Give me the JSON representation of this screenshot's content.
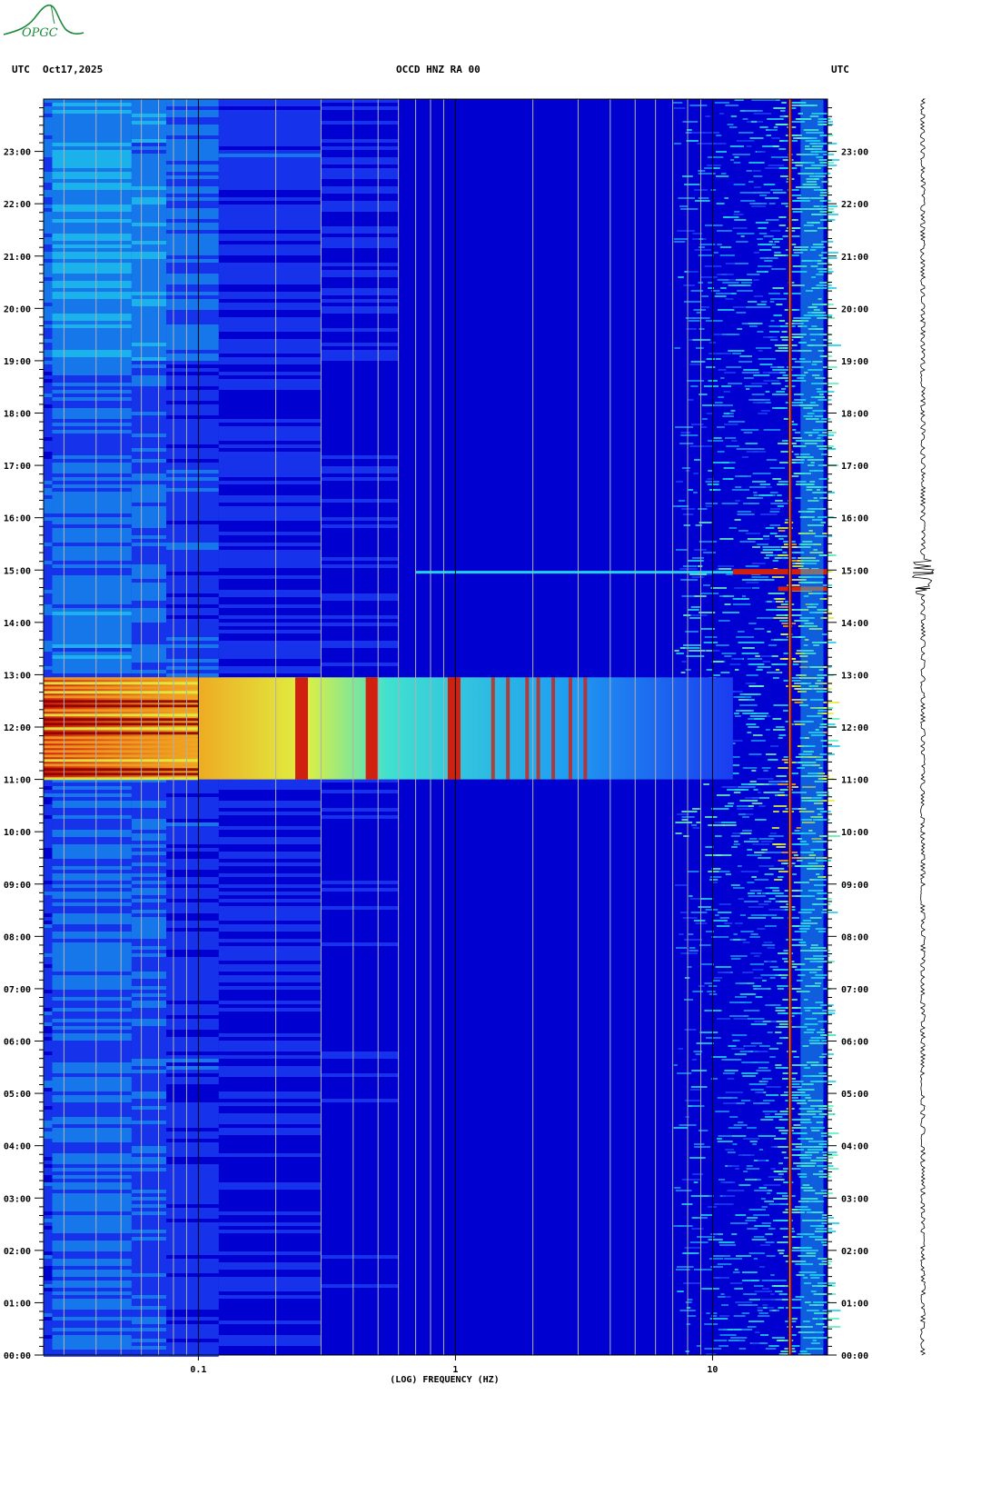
{
  "header": {
    "left_tz": "UTC",
    "date": "Oct17,2025",
    "station": "OCCD HNZ RA 00",
    "right_tz": "UTC"
  },
  "logo": {
    "text": "OPGC",
    "color": "#1a8a3a"
  },
  "chart_data": {
    "type": "heatmap",
    "title": "OCCD HNZ RA 00",
    "xlabel": "(LOG) FREQUENCY (HZ)",
    "ylabel": "",
    "x_scale": "log",
    "xlim": [
      0.025,
      28
    ],
    "ylim_hours": [
      0,
      24
    ],
    "x_tick_labels": [
      {
        "value": 0.1,
        "label": "0.1"
      },
      {
        "value": 1,
        "label": "1"
      },
      {
        "value": 10,
        "label": "10"
      }
    ],
    "y_tick_labels": [
      "00:00",
      "01:00",
      "02:00",
      "03:00",
      "04:00",
      "05:00",
      "06:00",
      "07:00",
      "08:00",
      "09:00",
      "10:00",
      "11:00",
      "12:00",
      "13:00",
      "14:00",
      "15:00",
      "16:00",
      "17:00",
      "18:00",
      "19:00",
      "20:00",
      "21:00",
      "22:00",
      "23:00"
    ],
    "colormap": [
      "#00008c",
      "#0000d0",
      "#1a3cf0",
      "#1a8cf0",
      "#20d0f0",
      "#60f0c0",
      "#e0f040",
      "#f0a020",
      "#d02010",
      "#8c0000"
    ],
    "features": [
      {
        "name": "broadband event",
        "start_hour": 11.0,
        "end_hour": 12.95,
        "max_freq_hz": 12
      },
      {
        "name": "high-frequency event",
        "hour": 14.95,
        "min_freq_hz": 0.7
      },
      {
        "name": "persistent tone",
        "freq_hz": 20
      }
    ],
    "grid": true
  },
  "trace": {
    "color": "#000000"
  }
}
